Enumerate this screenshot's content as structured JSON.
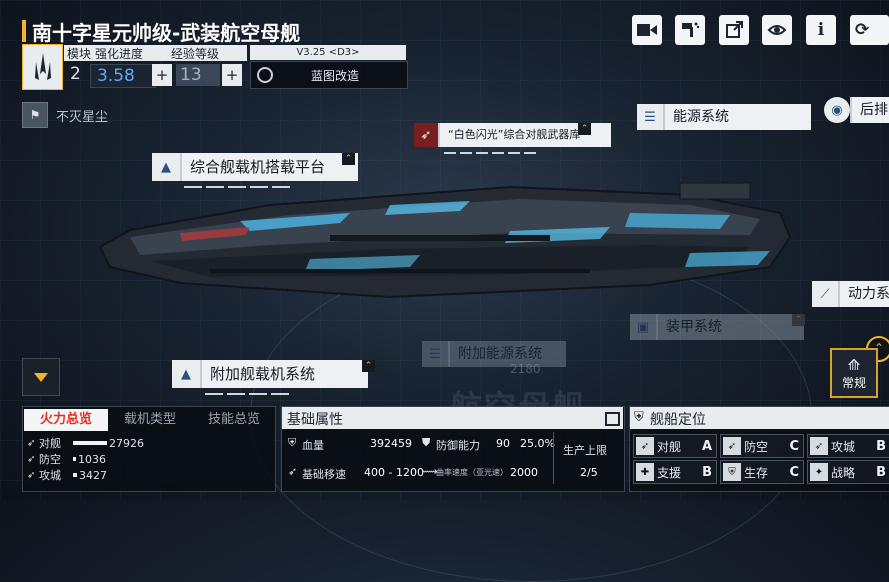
{
  "ship": {
    "title": "南十字星元帅级-武装航空母舰",
    "module_label": "模块",
    "enhance_label": "强化进度",
    "exp_label": "经验等级",
    "module_value": "2",
    "enhance_value": "3.58",
    "exp_value": "13",
    "version": "V3.25 <D3>",
    "blueprint_label": "蓝图改造"
  },
  "location": "不灭星尘",
  "systems": {
    "energy": "能源系统",
    "rear": "后排",
    "flash_weapon": "“白色闪光”综合对舰武器库",
    "carrier_platform": "综合舰载机搭载平台",
    "power": "动力系统",
    "armor": "装甲系统",
    "extra_energy": "附加能源系统",
    "extra_carrier": "附加舰载机系统",
    "number_2180": "2180",
    "watermark": "航空母舰"
  },
  "mode_button": "常规",
  "tabs": [
    "火力总览",
    "载机类型",
    "技能总览"
  ],
  "firepower": [
    {
      "label": "对舰",
      "value": "27926",
      "level": 1.0
    },
    {
      "label": "防空",
      "value": "1036",
      "level": 0.04
    },
    {
      "label": "攻城",
      "value": "3427",
      "level": 0.12
    }
  ],
  "attributes": {
    "title": "基础属性",
    "hp_label": "血量",
    "hp_value": "392459",
    "defense_label": "防御能力",
    "defense_value": "90",
    "defense_pct": "25.0%",
    "speed_label": "基础移速",
    "speed_value": "400 - 1200",
    "warp_label": "曲率速度（亚光速）",
    "warp_value": "2000",
    "prod_label": "生产上限",
    "prod_value": "2/5"
  },
  "positioning": {
    "title": "舰船定位",
    "items": [
      {
        "label": "对舰",
        "grade": "A"
      },
      {
        "label": "防空",
        "grade": "C"
      },
      {
        "label": "攻城",
        "grade": "B"
      },
      {
        "label": "支援",
        "grade": "B"
      },
      {
        "label": "生存",
        "grade": "C"
      },
      {
        "label": "战略",
        "grade": "B"
      }
    ]
  },
  "colors": {
    "accent": "#f2b52a",
    "enhance_blue": "#5aa9ff",
    "panel_light": "#e8ecef"
  }
}
